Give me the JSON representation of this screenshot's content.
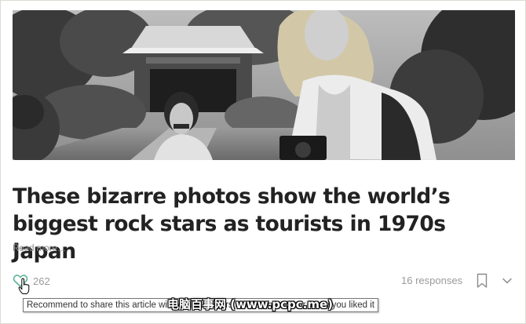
{
  "article": {
    "title": "These bizarre photos show the world’s biggest rock stars as tourists in 1970s Japan",
    "read_more": "Read more…",
    "recommend_count": "262",
    "responses": "16 responses"
  },
  "tooltip": {
    "text": "Recommend to share this article with your followers and let the author know you liked it"
  },
  "watermark": {
    "text": "电脑百事网 (www.pcpc.me)"
  },
  "icons": {
    "heart": "heart-icon",
    "bookmark": "bookmark-icon",
    "chevron": "chevron-down-icon",
    "cursor": "hand-cursor-icon"
  },
  "colors": {
    "recommend_accent": "#5fb39a",
    "muted_text": "#9a9a9a",
    "headline": "#222222"
  }
}
